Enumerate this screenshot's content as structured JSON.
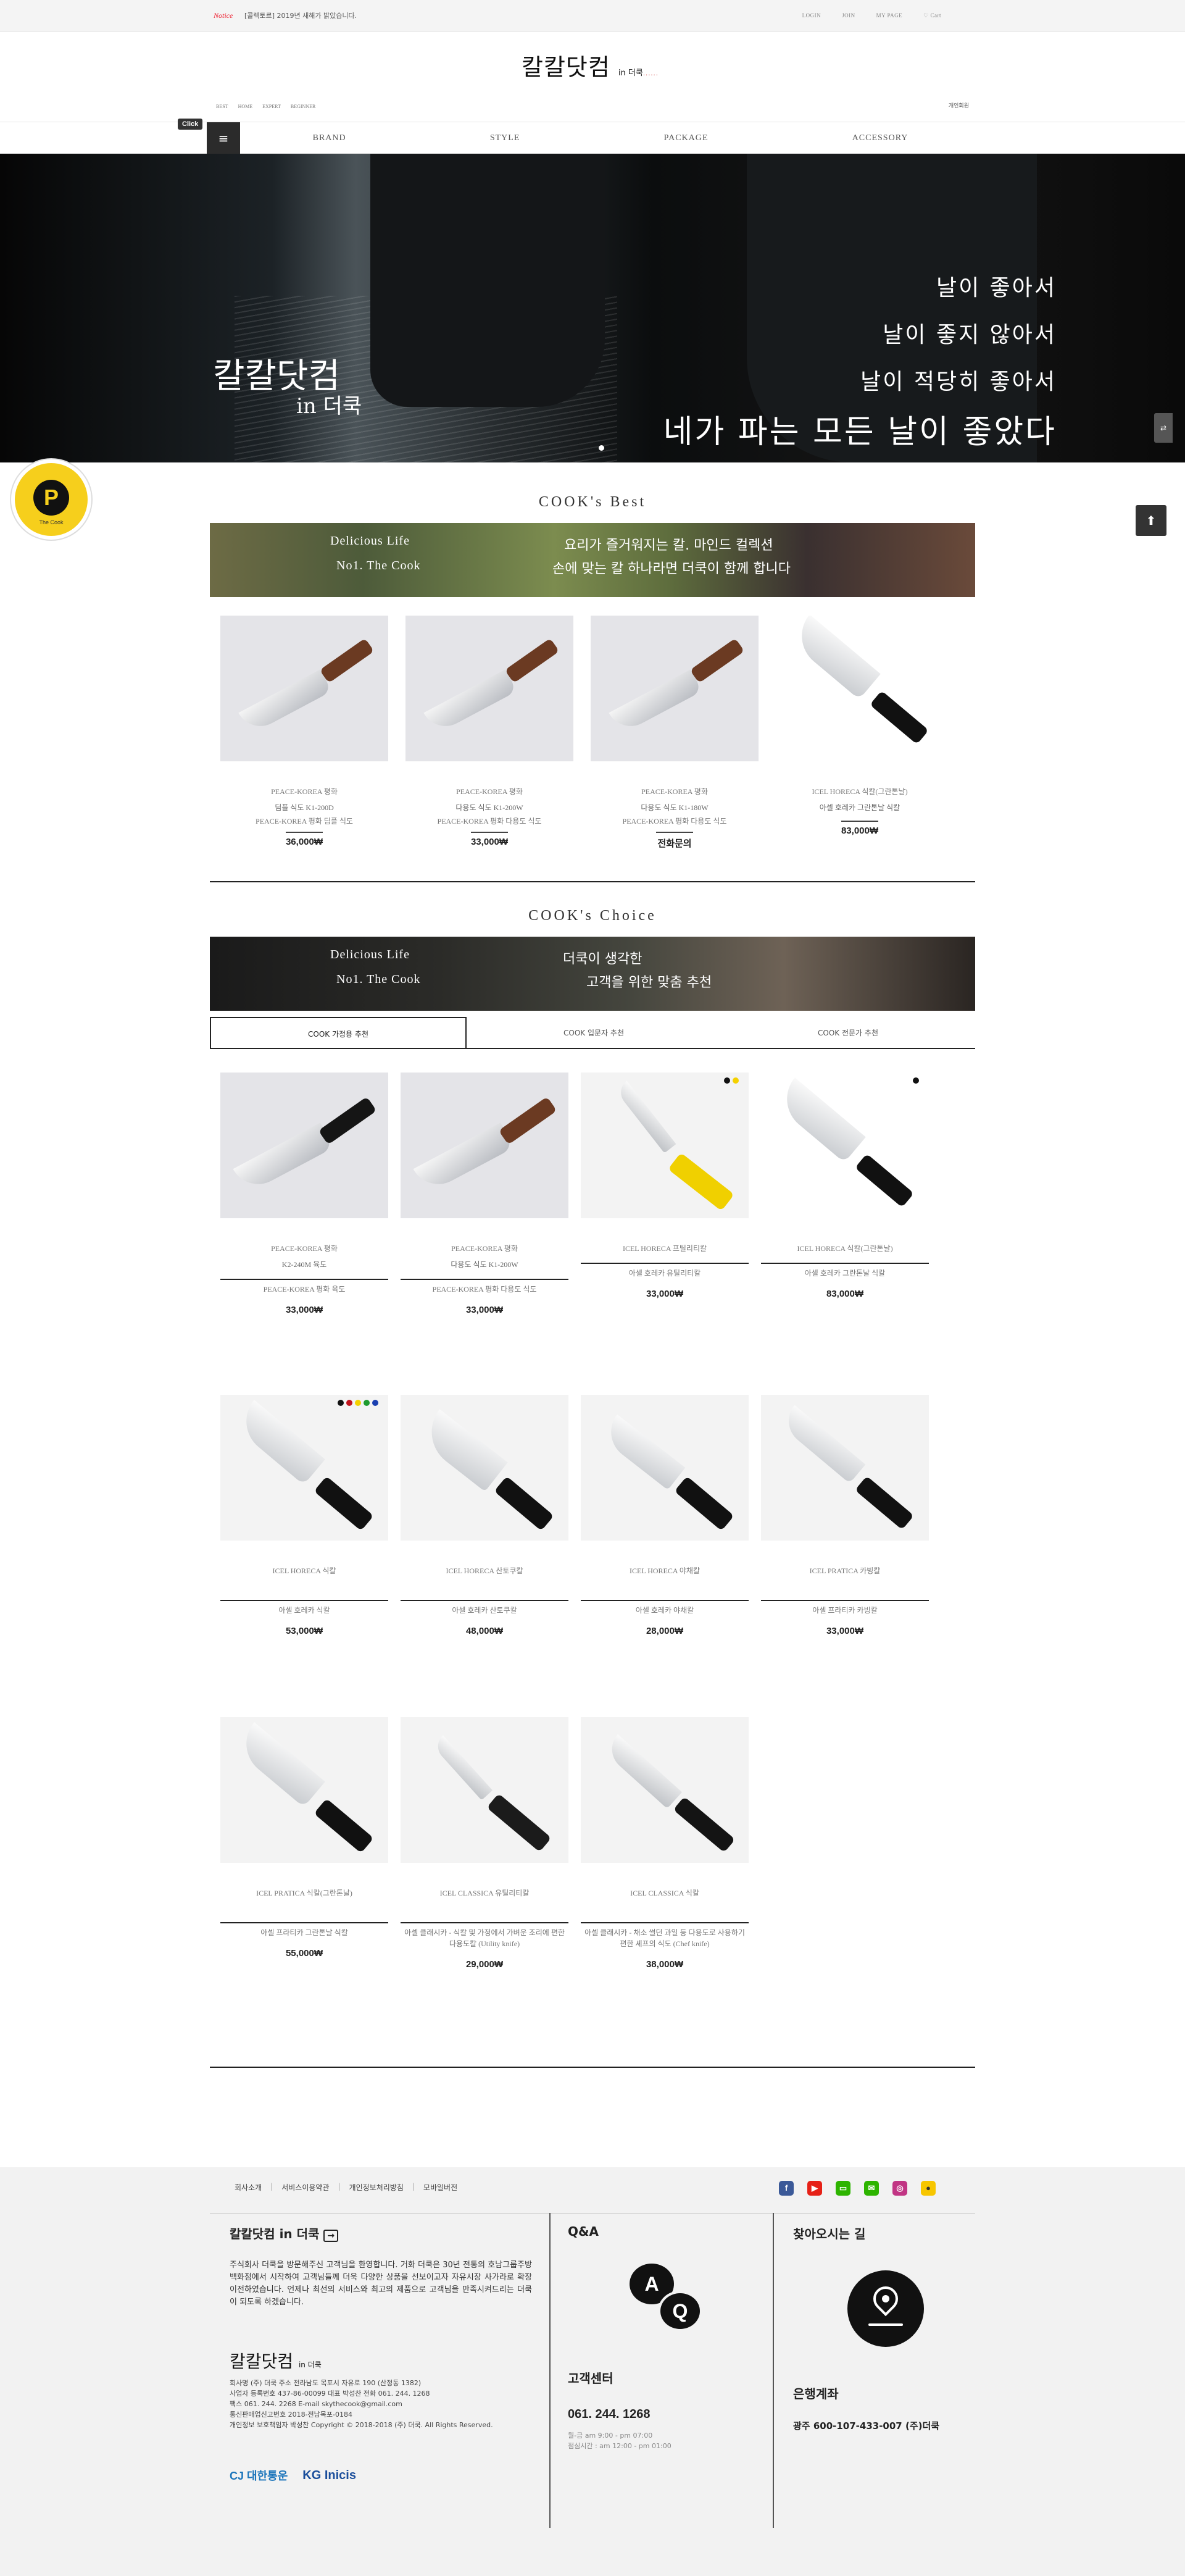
{
  "topbar": {
    "notice_label": "Notice",
    "notice_text": "[콜렉토르] 2019년 새해가 밝았습니다.",
    "links": [
      "LOGIN",
      "JOIN",
      "MY PAGE",
      "♡ Cart"
    ]
  },
  "logo": {
    "main": "칼칼닷컴",
    "small": "in 더쿡",
    "dots": "......"
  },
  "subnav": [
    "BEST",
    "HOME",
    "EXPERT",
    "BEGINNER"
  ],
  "cart_mini": "개인회원",
  "mainnav": {
    "click_tag": "Click",
    "menu_icon": "≡",
    "items": [
      "BRAND",
      "STYLE",
      "PACKAGE",
      "ACCESSORY"
    ]
  },
  "hero": {
    "brand_line1": "칼칼닷컴",
    "brand_line2": "in 더쿡",
    "lines": [
      "날이 좋아서",
      "날이 좋지 않아서",
      "날이 적당히 좋아서"
    ],
    "big_line": "네가 파는 모든 날이 좋았다"
  },
  "side_tab": "⇄",
  "up_button": "⬆",
  "badge": {
    "letter": "P",
    "text": "The Cook"
  },
  "best": {
    "title": "COOK's Best",
    "banner": {
      "l1": "Delicious Life",
      "l2": "No1. The Cook",
      "r1": "요리가 즐거워지는 칼. 마인드 컬렉션",
      "r2": "손에 맞는 칼 하나라면 더쿡이 함께 합니다"
    },
    "products": [
      {
        "name": "PEACE-KOREA 평화",
        "sub": "딤플 식도 K1-200D",
        "desc": "PEACE-KOREA 평화 딤플 식도",
        "price": "36,000₩"
      },
      {
        "name": "PEACE-KOREA 평화",
        "sub": "다용도 식도 K1-200W",
        "desc": "PEACE-KOREA 평화 다용도 식도",
        "price": "33,000₩"
      },
      {
        "name": "PEACE-KOREA 평화",
        "sub": "다용도 식도 K1-180W",
        "desc": "PEACE-KOREA 평화 다용도 식도",
        "price": "전화문의"
      },
      {
        "name": "ICEL HORECA 식칼(그란톤날)",
        "sub": "아셀 호레카 그란톤날 식칼",
        "desc": "",
        "price": "83,000₩"
      }
    ]
  },
  "choice": {
    "title": "COOK's Choice",
    "banner": {
      "l1": "Delicious Life",
      "l2": "No1. The Cook",
      "r1": "더쿡이 생각한",
      "r2": "고객을 위한 맞춤 추천"
    },
    "tabs": [
      "COOK 가정용 추천",
      "COOK 입문자 추천",
      "COOK 전문가 추천"
    ],
    "products": [
      {
        "name": "PEACE-KOREA 평화",
        "sub": "K2-240M 육도",
        "desc": "PEACE-KOREA 평화 육도",
        "price": "33,000₩"
      },
      {
        "name": "PEACE-KOREA 평화",
        "sub": "다용도 식도 K1-200W",
        "desc": "PEACE-KOREA 평화 다용도 식도",
        "price": "33,000₩"
      },
      {
        "name": "ICEL HORECA 프틸리티칼",
        "sub": "",
        "desc": "아셀 호레카 유틸리티칼",
        "price": "33,000₩"
      },
      {
        "name": "ICEL HORECA 식칼(그란톤날)",
        "sub": "",
        "desc": "아셀 호레카 그란톤날 식칼",
        "price": "83,000₩"
      },
      {
        "name": "ICEL HORECA 식칼",
        "sub": "",
        "desc": "아셀 호레카 식칼",
        "price": "53,000₩"
      },
      {
        "name": "ICEL HORECA 산토쿠칼",
        "sub": "",
        "desc": "아셀 호레카 산토쿠칼",
        "price": "48,000₩"
      },
      {
        "name": "ICEL HORECA 야채칼",
        "sub": "",
        "desc": "아셀 호레카 야채칼",
        "price": "28,000₩"
      },
      {
        "name": "ICEL PRATICA 카빙칼",
        "sub": "",
        "desc": "아셀 프라티카 카빙칼",
        "price": "33,000₩"
      },
      {
        "name": "ICEL PRATICA 식칼(그란톤날)",
        "sub": "",
        "desc": "아셀 프라티카 그란톤날 식칼",
        "price": "55,000₩"
      },
      {
        "name": "ICEL CLASSICA 유틸리티칼",
        "sub": "",
        "desc": "아셀 클래시카 - 식칼 및 가정에서 가벼운 조리에 편한 다용도칼  (Utility knife)",
        "price": "29,000₩"
      },
      {
        "name": "ICEL CLASSICA 식칼",
        "sub": "",
        "desc": "아셀 클래시카 - 채소 썰던 과일 등 다용도로 사용하기 편한 셰프의 식도  (Chef knife)",
        "price": "38,000₩"
      }
    ]
  },
  "footer": {
    "links": [
      "회사소개",
      "서비스이용약관",
      "개인정보처리방침",
      "모바일버전"
    ],
    "social": [
      "f",
      "▶",
      "▭",
      "✉",
      "◎",
      "●"
    ],
    "col1": {
      "title": "칼칼닷컴 in 더쿡",
      "arrow": "→",
      "text": "주식회사 더쿡을 방문해주신 고객님을 환영합니다. 거화 더쿡은 30년 전통의 호남그룹주방백화점에서 시작하여 고객님들께 더욱 다양한 상품을 선보이고자 자유시장 사가라로 확장이전하였습니다. 언제나 최선의 서비스와 최고의 제품으로 고객님을 만족시켜드리는 더쿡이 되도록 하겠습니다.",
      "logo": "칼칼닷컴",
      "logo_small": "in 더쿡",
      "info": [
        "회사명 (주) 더쿡 주소 전라남도 목포시 자유로 190 (산정동 1382)",
        "사업자 등록번호 437-86-00099 대표 박성찬 전화 061. 244. 1268",
        "팩스 061. 244. 2268 E-mail skythecook@gmail.com",
        "통신판매업신고번호 2018-전남목포-0184",
        "개인정보 보호책임자 박성찬 Copyright © 2018-2018 (주) 더쿡. All Rights Reserved."
      ],
      "partners": [
        "CJ 대한통운",
        "KG Inicis"
      ]
    },
    "col2": {
      "title": "Q&A",
      "subtitle": "고객센터",
      "phone": "061. 244. 1268",
      "hours": [
        "월-금 am 9:00 - pm 07:00",
        "점심시간 : am 12:00 - pm 01:00"
      ]
    },
    "col3": {
      "title": "찾아오시는 길",
      "subtitle": "은행계좌",
      "account": "광주 600-107-433-007 (주)더쿡"
    }
  }
}
